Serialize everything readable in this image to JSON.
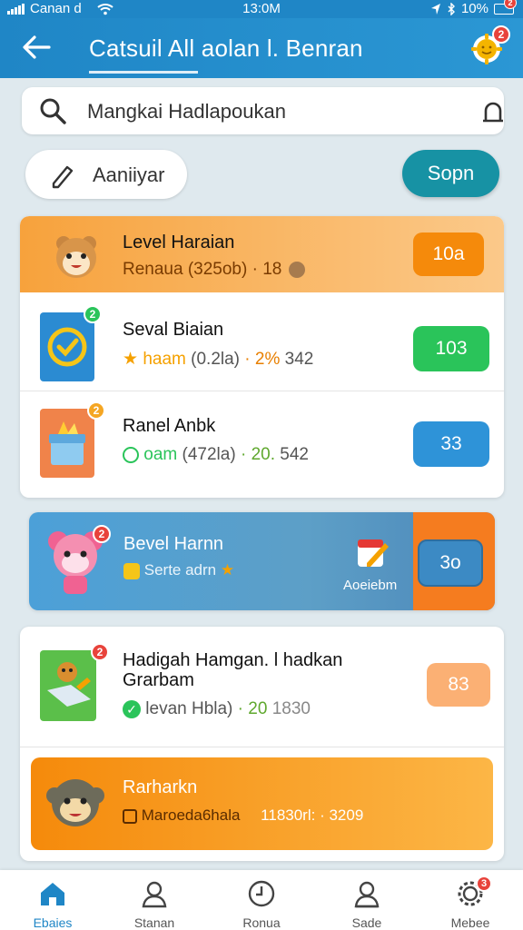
{
  "status_bar": {
    "carrier": "Canan d",
    "time": "13:0M",
    "battery": "10%",
    "notification_count": "2"
  },
  "header": {
    "title": "Catsuil All aolan l. Benran",
    "notification_count": "2"
  },
  "search": {
    "text": "Mangkai Hadlapoukan"
  },
  "filter": {
    "label": "Aaniiyar"
  },
  "sort": {
    "label": "Sopn"
  },
  "list": [
    {
      "title": "Level Haraian",
      "subtitle": "Renaua (325ob) · 18",
      "value": "10a",
      "style": "highlight-orange"
    },
    {
      "title": "Seval Biaian",
      "subtitle_a": "haam",
      "subtitle_b": "(0.2la)",
      "subtitle_c": "· 2%",
      "subtitle_d": "342",
      "value": "103",
      "badge": "2",
      "accent": "#2ac45a"
    },
    {
      "title": "Ranel Anbk",
      "subtitle_a": "oam",
      "subtitle_b": "(472la)",
      "subtitle_c": "· 20.",
      "subtitle_d": "542",
      "value": "33",
      "badge": "2",
      "accent": "#2e93d8"
    },
    {
      "title": "Bevel Harnn",
      "subtitle": "Serte adrn",
      "side_label": "Aoeiebm",
      "value": "3o",
      "badge": "2",
      "style": "highlight-blue"
    },
    {
      "title_line1": "Hadigah Hamgan. l hadkan",
      "title_line2": "Grarbam",
      "subtitle_b": "levan Hbla)",
      "subtitle_c": "· 20",
      "subtitle_d": "1830",
      "value": "83",
      "badge": "2",
      "accent": "#fbb074"
    },
    {
      "title": "Rarharkn",
      "subtitle": "Maroeda6hala",
      "extra": "11830rl: · 3209",
      "style": "highlight-orange"
    }
  ],
  "bottom_nav": [
    {
      "label": "Ebaies",
      "icon": "home-icon",
      "active": true
    },
    {
      "label": "Stanan",
      "icon": "user-icon"
    },
    {
      "label": "Ronua",
      "icon": "clock-icon"
    },
    {
      "label": "Sade",
      "icon": "profile-icon"
    },
    {
      "label": "Mebee",
      "icon": "gear-icon",
      "badge": "3"
    }
  ],
  "colors": {
    "brand_blue": "#1f86c6",
    "orange": "#f59e24",
    "teal": "#1792a4",
    "green": "#2ac45a",
    "blue_pill": "#2e93d8",
    "red_badge": "#e8433b"
  }
}
